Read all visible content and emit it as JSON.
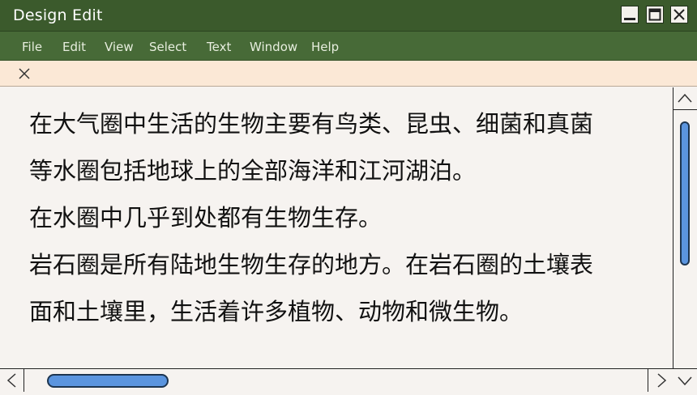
{
  "window": {
    "title": "Design Edit"
  },
  "menubar": {
    "items": [
      "File",
      "Edit",
      "View",
      "Select",
      "Text",
      "Window",
      "Help"
    ]
  },
  "tab": {
    "close_icon": "close-icon"
  },
  "document": {
    "lines": [
      "在大气圈中生活的生物主要有鸟类、昆虫、细菌和真菌",
      "等水圈包括地球上的全部海洋和江河湖泊。",
      "在水圈中几乎到处都有生物生存。",
      "岩石圈是所有陆地生物生存的地方。在岩石圈的土壤表",
      "面和土壤里，生活着许多植物、动物和微生物。"
    ]
  },
  "colors": {
    "titlebar": "#3b5a2c",
    "menubar": "#476a37",
    "tabbar": "#fbe8d6",
    "scroll_thumb": "#5b95df"
  }
}
